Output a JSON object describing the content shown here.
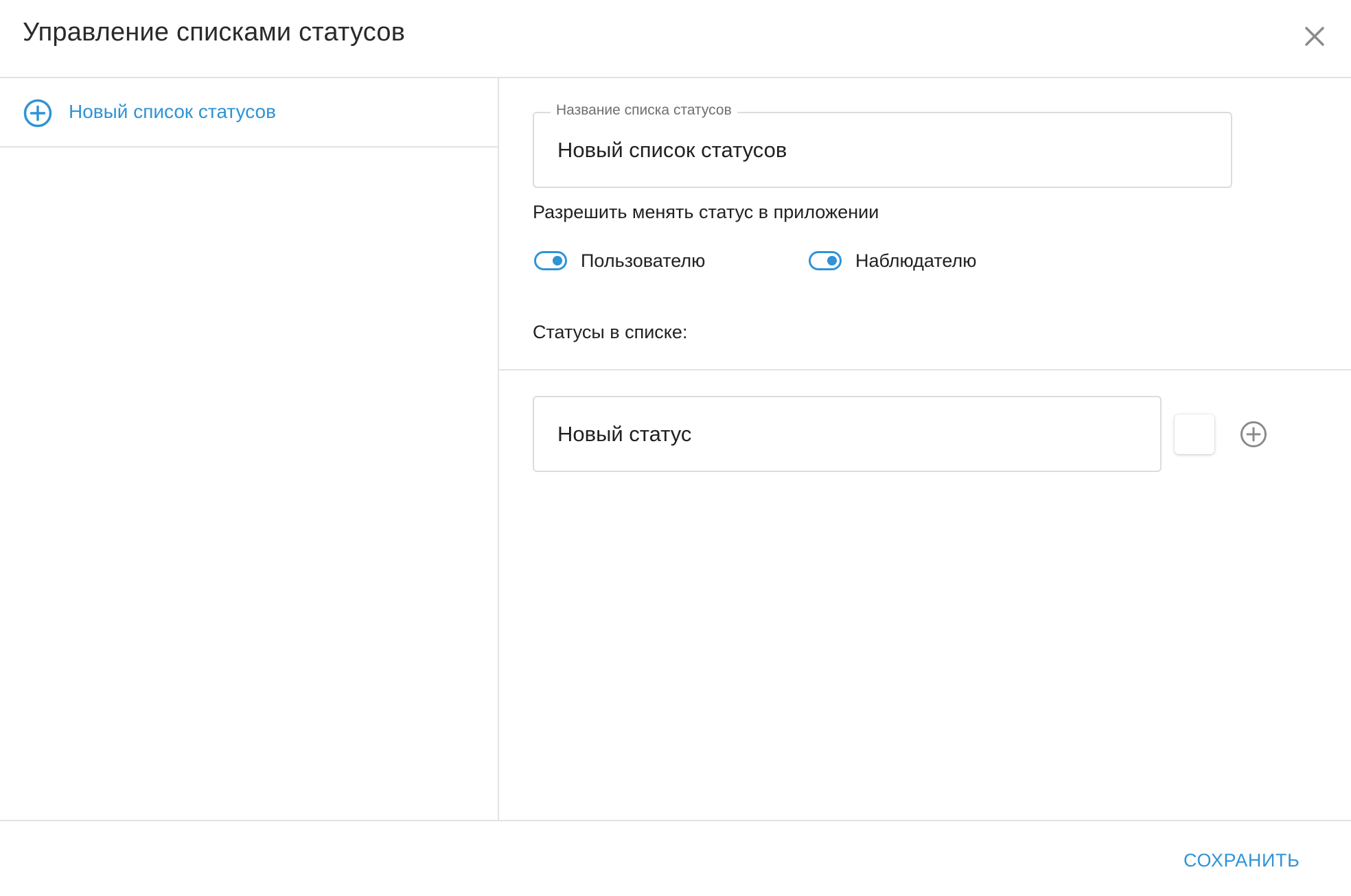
{
  "dialog": {
    "title": "Управление списками статусов",
    "close_icon": "close-icon"
  },
  "sidebar": {
    "new_list": {
      "label": "Новый список статусов",
      "icon": "plus-circle-icon"
    }
  },
  "form": {
    "name_field": {
      "label": "Название списка статусов",
      "value": "Новый список статусов"
    },
    "permissions": {
      "title": "Разрешить менять статус в приложении",
      "toggles": [
        {
          "label": "Пользователю",
          "enabled": true
        },
        {
          "label": "Наблюдателю",
          "enabled": true
        }
      ]
    },
    "statuses": {
      "title": "Статусы в списке:",
      "items": [
        {
          "value": "Новый статус",
          "color": "#ffffff"
        }
      ],
      "add_icon": "plus-circle-icon"
    }
  },
  "footer": {
    "save_label": "СОХРАНИТЬ"
  },
  "colors": {
    "accent": "#2f93d6",
    "border": "#dcdcdc",
    "divider": "#e3e3e3",
    "text": "#212121",
    "muted_icon": "#8a8a8a"
  }
}
